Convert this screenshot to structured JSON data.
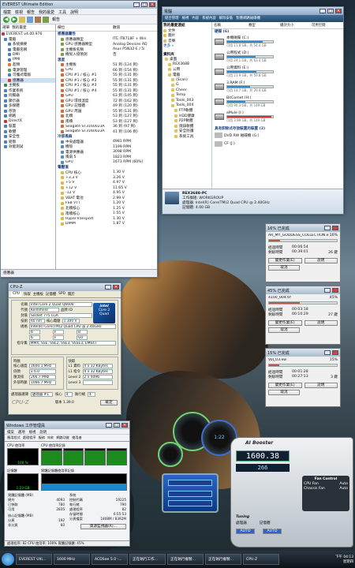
{
  "everest": {
    "title": "EVEREST Ultimate Edition",
    "menu": [
      "檔案",
      "檢視",
      "報告",
      "我的最愛",
      "工具",
      "說明"
    ],
    "toolbar_label": "報告",
    "tabs": [
      "選單",
      "我的最愛"
    ],
    "col_field": "欄位",
    "col_value": "數值",
    "tree": [
      "EVEREST v4.00.976",
      "電腦",
      "系統摘要",
      "電腦名稱",
      "DMI",
      "IPMI",
      "超頻",
      "電源管理",
      "可攜式電腦",
      "感應器",
      "主機板",
      "作業系統",
      "伺服器",
      "顯示器",
      "多媒體",
      "存放",
      "網路",
      "DirectX",
      "裝置",
      "軟體",
      "安全性",
      "組態",
      "效能測試"
    ],
    "sections": [
      {
        "h": "感應器屬性",
        "rows": [
          [
            "感應器類型",
            "ITE IT8718F + Win"
          ],
          [
            "GPU 感應器類型",
            "Analog Devices AD"
          ],
          [
            "主機板名稱",
            "Asus P5N32-E / 5i"
          ],
          [
            "機殼入侵偵測",
            "否"
          ]
        ]
      },
      {
        "h": "溫度",
        "rows": [
          [
            "主機板",
            "51 到 (124 到)"
          ],
          [
            "CPU",
            "66 到 (154 到)"
          ],
          [
            "CPU #1 / 核心 #1",
            "55 到 (131 到)"
          ],
          [
            "CPU #1 / 核心 #2",
            "55 到 (131 到)"
          ],
          [
            "CPU #1 / 核心 #3",
            "55 到 (131 到)"
          ],
          [
            "CPU #1 / 核心 #4",
            "55 到 (131 到)"
          ],
          [
            "GPU",
            "63 到 (145 到)"
          ],
          [
            "GPU 環境溫度",
            "72 到 (162 到)"
          ],
          [
            "GPU 記憶體",
            "49 到 (120 到)"
          ],
          [
            "GPU 周邊",
            "55 到 (131 到)"
          ],
          [
            "北橋",
            "53 到 (127 到)"
          ],
          [
            "南橋",
            "53 到 (127 到)"
          ],
          [
            "Seagate ST3160023A",
            "36 到 (97 到)"
          ],
          [
            "Seagate ST3160023A",
            "41 到 (106 到)"
          ]
        ]
      },
      {
        "h": "冷卻風扇",
        "rows": [
          [
            "中央處理器",
            "4981 RPM"
          ],
          [
            "機殼",
            "1199 RPM"
          ],
          [
            "電源供應器",
            "3098 RPM"
          ],
          [
            "風扇 5",
            "1823 RPM"
          ],
          [
            "GPU",
            "1673 RPM (60%)"
          ]
        ]
      },
      {
        "h": "電壓值",
        "rows": [
          [
            "CPU 核心",
            "1.30 V"
          ],
          [
            "+3.3 V",
            "3.26 V"
          ],
          [
            "+5 V",
            "4.97 V"
          ],
          [
            "+12 V",
            "11.65 V"
          ],
          [
            "-12 V",
            "4.95 V"
          ],
          [
            "VBAT 電池",
            "2.99 V"
          ],
          [
            "FSB VTT",
            "1.20 V"
          ],
          [
            "北橋核心",
            "1.25 V"
          ],
          [
            "南橋核心",
            "1.55 V"
          ],
          [
            "HyperTransport",
            "1.30 V"
          ],
          [
            "DIMM",
            "1.87 V"
          ]
        ]
      }
    ],
    "status": "感應器"
  },
  "explorer": {
    "title": "電腦",
    "toolbar": [
      "組合管理",
      "檢視",
      "內容",
      "系統內容",
      "解除安裝",
      "對應網路磁碟機"
    ],
    "cols": [
      "名稱",
      "類型",
      "總計大小",
      "可用空間"
    ],
    "fav_header": "我的最愛連結",
    "favs": [
      "文件",
      "圖片",
      "音樂"
    ],
    "more": "更多 »",
    "folders_header": "資料夾",
    "tree": [
      "桌面",
      "REX3688",
      "公用",
      "電腦",
      "(Scan)",
      "G",
      "Cheer",
      "Temp",
      "Tools_003",
      "Tools_004",
      "FTP軟體",
      "HDD健康",
      "P2P軟體",
      "燒錄軟體",
      "安全防護",
      "系統工具"
    ],
    "hdd_header": "硬碟 (6)",
    "drives": [
      {
        "name": "本機磁碟 (C:)",
        "free": "可用 11.8 GB，共 54.4 GB",
        "pct": 78
      },
      {
        "name": "公用程式 (D:)",
        "free": "可用 24.1 GB，共 63.4 GB",
        "pct": 62
      },
      {
        "name": "公用資料 (E:)",
        "free": "可用 21.9 GB，共 59.8 GB",
        "pct": 63
      },
      {
        "name": "3.RAM (F:)",
        "free": "可用 14.7 GB，共 29.4 GB",
        "pct": 50
      },
      {
        "name": "BitComet (H:)",
        "free": "可用 90.3 GB，共 149 GB",
        "pct": 39
      },
      {
        "name": "aMule (I:)",
        "free": "可用 3.99 GB，共 149 GB",
        "pct": 97
      }
    ],
    "removable_header": "具有卸除式存放裝置的裝置 (2)",
    "removables": [
      "DVD RW 磁碟機 (G:)",
      "CF (J:)"
    ],
    "pc_name": "REX3688-PC",
    "workgroup_label": "工作群組:",
    "workgroup": "WORKGROUP",
    "cpu_label": "處理器:",
    "cpu": "Intel(R) Core(TM)2 Quad CPU    @ 2.40GHz",
    "mem_label": "記憶體:",
    "mem": "4.00 GB"
  },
  "copies": [
    {
      "title": "16% 已完成",
      "from": "AR_MY_GODDESS_COLLECTION.e",
      "pct_label": "16%",
      "pct": 16,
      "elapsed_label": "經過時間",
      "elapsed": "00:06:54",
      "remain_label": "剩餘時間",
      "remain": "00:39:01",
      "extra": "26 鍵",
      "btns": [
        "變更作業(E)",
        "說明"
      ],
      "cancel": "取消"
    },
    {
      "title": "45% 已完成",
      "from": "4100_004.tif",
      "pct_label": "45%",
      "pct": 45,
      "elapsed_label": "經過時間",
      "elapsed": "00:03:18",
      "remain_label": "剩餘時間",
      "remain": "00:10:29",
      "extra": "27 鍵",
      "btns": [
        "變更作業(E)",
        "說明"
      ],
      "cancel": "取消"
    },
    {
      "title": "15% 已完成",
      "from": "Vol_03.ew",
      "pct_label": "15%",
      "pct": 15,
      "elapsed_label": "經過時間",
      "elapsed": "00:01:28",
      "remain_label": "剩餘時間",
      "remain": "00:27:13",
      "extra": "3 鍵",
      "btns": [
        "變更作業(E)",
        "說明"
      ],
      "cancel": "取消"
    }
  ],
  "cpuz": {
    "tabs": [
      "CPU",
      "快取",
      "主機板",
      "記憶體",
      "SPD",
      "關於"
    ],
    "name_label": "名稱",
    "name": "Intel Core 2 Quad Q6600",
    "code_label": "代號",
    "code": "Kentsfield",
    "brand_label": "品牌 ID",
    "pkg_label": "封裝",
    "pkg": "Socket 775 LGA",
    "tech_label": "技術",
    "tech": "65 nm",
    "volt_label": "核心電壓",
    "volt": "1.300 V",
    "spec_label": "規格",
    "spec": "Intel(R) Core(TM)2 Quad CPU  @ 2.40GHz",
    "family": "6",
    "model": "F",
    "stepping": "B",
    "extfamily": "6",
    "extmodel": "F",
    "revision": "G0",
    "instr_label": "指令集",
    "instr": "MMX, SSE, SSE2, SSE3, SSSE3, EM64T",
    "clock_label": "時脈",
    "speed_label": "核心速度",
    "speed": "1600.1 MHz",
    "mult_label": "倍頻",
    "mult": "x 6.0",
    "bus_label": "匯流排",
    "bus": "266.7 MHz",
    "fsb_label": "外部時脈",
    "fsb": "1066.7 MHz",
    "cache_label": "快取",
    "l1d_label": "L1 資料",
    "l1d": "4 x 32 KBytes",
    "l1i_label": "L1 指令",
    "l1i": "4 x 32 KBytes",
    "l2_label": "Level 2",
    "l2": "2 x 4096 KBytes",
    "l3_label": "Level 3",
    "sel_label": "處理器選擇",
    "sel": "處理器 #1",
    "cores_label": "核心",
    "cores": "4",
    "threads_label": "執行緒",
    "threads": "4",
    "version": "版本 1.39.0",
    "ok": "確定",
    "brand": "CPU-Z",
    "intel_line1": "intel",
    "intel_line2": "Core 2",
    "intel_line3": "Quad"
  },
  "taskmgr": {
    "title": "Windows 工作管理員",
    "menu": [
      "檔案",
      "選項",
      "檢視",
      "說明"
    ],
    "tabs": [
      "應用程式",
      "處理程序",
      "服務",
      "效能",
      "網路功能",
      "使用者"
    ],
    "cpu_usage": "CPU 使用率",
    "cpu_history": "CPU 使用率記錄",
    "mem": "記憶體",
    "mem_history": "實體記憶體使用率記錄",
    "cpu_pct": "100 %",
    "mem_val": "1.23 GB",
    "phys_label": "實體記憶體 (MB)",
    "phys": [
      [
        "總共",
        "4093"
      ],
      [
        "已快取",
        "780"
      ],
      [
        "可用",
        "2835"
      ]
    ],
    "sys_label": "系統",
    "sys": [
      [
        "控制代碼",
        "19225"
      ],
      [
        "執行緒",
        "790"
      ],
      [
        "處理程序",
        "82"
      ],
      [
        "存留時間",
        "6:55:53"
      ],
      [
        "分頁檔案",
        "1808M / 8392M"
      ]
    ],
    "kernel_label": "核心記憶體 (MB)",
    "kernel": [
      [
        "分頁",
        "192"
      ],
      [
        "非分頁",
        "60"
      ]
    ],
    "res_btn": "資源監視器(R)...",
    "status": "處理程序: 82    CPU 使用率: 100%    實體記憶體: 45%"
  },
  "aibooster": {
    "brand": "AI Booster",
    "time": "1:22",
    "fan_title": "Fan Control",
    "fans": [
      [
        "CPU Fan",
        "Auto"
      ],
      [
        "Chassis Fan",
        "Auto"
      ]
    ],
    "tuning": "Tuning",
    "cpu_label": "處理器",
    "mem_label": "記憶體",
    "auto": "AUTO",
    "freq": "1600.38",
    "fsb": "266"
  },
  "taskbar": {
    "items": [
      "EVEREST Ulti...",
      "1600 MHz",
      "ACDSee 5.0 -...",
      "正在執行工作...",
      "正在執行複製...",
      "正在執行複製...",
      "CPU-Z"
    ],
    "clock": "下午 04:13",
    "date": "星期四"
  }
}
